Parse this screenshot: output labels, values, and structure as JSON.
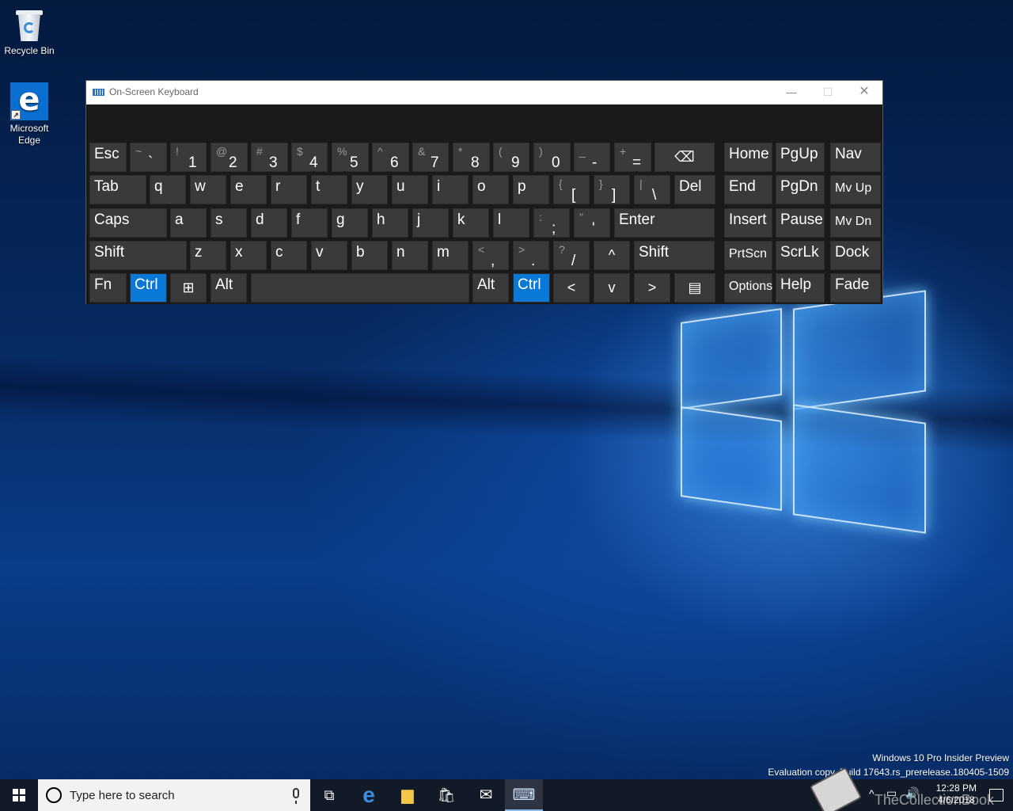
{
  "desktop": {
    "icons": [
      {
        "label": "Recycle Bin",
        "glyph": "recycle-bin-icon"
      },
      {
        "label": "Microsoft Edge",
        "glyph": "edge-icon"
      }
    ],
    "watermark_line1": "Windows 10 Pro Insider Preview",
    "watermark_line2": "Evaluation copy. Build 17643.rs_prerelease.180405-1509",
    "brand_text": "TheCollectionBook"
  },
  "osk": {
    "title": "On-Screen Keyboard",
    "minimize": "—",
    "maximize": "☐",
    "close": "✕",
    "rows": [
      [
        {
          "id": "esc",
          "main": "Esc"
        },
        {
          "id": "backtick",
          "shift": "~",
          "base": "`"
        },
        {
          "id": "k1",
          "shift": "!",
          "base": "1"
        },
        {
          "id": "k2",
          "shift": "@",
          "base": "2"
        },
        {
          "id": "k3",
          "shift": "#",
          "base": "3"
        },
        {
          "id": "k4",
          "shift": "$",
          "base": "4"
        },
        {
          "id": "k5",
          "shift": "%",
          "base": "5"
        },
        {
          "id": "k6",
          "shift": "^",
          "base": "6"
        },
        {
          "id": "k7",
          "shift": "&",
          "base": "7"
        },
        {
          "id": "k8",
          "shift": "*",
          "base": "8"
        },
        {
          "id": "k9",
          "shift": "(",
          "base": "9"
        },
        {
          "id": "k0",
          "shift": ")",
          "base": "0"
        },
        {
          "id": "minus",
          "shift": "_",
          "base": "-"
        },
        {
          "id": "equals",
          "shift": "+",
          "base": "="
        },
        {
          "id": "backspace",
          "icon": "⌫"
        },
        {
          "id": "home",
          "main": "Home"
        },
        {
          "id": "pgup",
          "main": "PgUp"
        },
        {
          "id": "nav",
          "main": "Nav"
        }
      ],
      [
        {
          "id": "tab",
          "main": "Tab"
        },
        {
          "id": "q",
          "main": "q"
        },
        {
          "id": "w",
          "main": "w"
        },
        {
          "id": "e",
          "main": "e"
        },
        {
          "id": "r",
          "main": "r"
        },
        {
          "id": "t",
          "main": "t"
        },
        {
          "id": "y",
          "main": "y"
        },
        {
          "id": "u",
          "main": "u"
        },
        {
          "id": "i",
          "main": "i"
        },
        {
          "id": "o",
          "main": "o"
        },
        {
          "id": "p",
          "main": "p"
        },
        {
          "id": "lbracket",
          "shift": "{",
          "base": "["
        },
        {
          "id": "rbracket",
          "shift": "}",
          "base": "]"
        },
        {
          "id": "backslash",
          "shift": "|",
          "base": "\\"
        },
        {
          "id": "del",
          "main": "Del"
        },
        {
          "id": "end",
          "main": "End"
        },
        {
          "id": "pgdn",
          "main": "PgDn"
        },
        {
          "id": "mvup",
          "main": "Mv Up",
          "small": true
        }
      ],
      [
        {
          "id": "caps",
          "main": "Caps"
        },
        {
          "id": "a",
          "main": "a"
        },
        {
          "id": "s",
          "main": "s"
        },
        {
          "id": "d",
          "main": "d"
        },
        {
          "id": "f",
          "main": "f"
        },
        {
          "id": "g",
          "main": "g"
        },
        {
          "id": "h",
          "main": "h"
        },
        {
          "id": "j",
          "main": "j"
        },
        {
          "id": "k",
          "main": "k"
        },
        {
          "id": "l",
          "main": "l"
        },
        {
          "id": "semicolon",
          "shift": ":",
          "base": ";"
        },
        {
          "id": "quote",
          "shift": "\"",
          "base": "'"
        },
        {
          "id": "enter",
          "main": "Enter"
        },
        {
          "id": "insert",
          "main": "Insert"
        },
        {
          "id": "pause",
          "main": "Pause"
        },
        {
          "id": "mvdn",
          "main": "Mv Dn",
          "small": true
        }
      ],
      [
        {
          "id": "lshift",
          "main": "Shift"
        },
        {
          "id": "z",
          "main": "z"
        },
        {
          "id": "x",
          "main": "x"
        },
        {
          "id": "c",
          "main": "c"
        },
        {
          "id": "v",
          "main": "v"
        },
        {
          "id": "b",
          "main": "b"
        },
        {
          "id": "n",
          "main": "n"
        },
        {
          "id": "m",
          "main": "m"
        },
        {
          "id": "comma",
          "shift": "<",
          "base": ","
        },
        {
          "id": "period",
          "shift": ">",
          "base": "."
        },
        {
          "id": "slash",
          "shift": "?",
          "base": "/"
        },
        {
          "id": "up",
          "icon": "^"
        },
        {
          "id": "rshift",
          "main": "Shift"
        },
        {
          "id": "prtscn",
          "main": "PrtScn",
          "small": true
        },
        {
          "id": "scrlk",
          "main": "ScrLk"
        },
        {
          "id": "dock",
          "main": "Dock"
        }
      ],
      [
        {
          "id": "fn",
          "main": "Fn"
        },
        {
          "id": "lctrl",
          "main": "Ctrl",
          "active": true
        },
        {
          "id": "win",
          "icon": "⊞"
        },
        {
          "id": "lalt",
          "main": "Alt"
        },
        {
          "id": "space",
          "main": ""
        },
        {
          "id": "ralt",
          "main": "Alt"
        },
        {
          "id": "rctrl",
          "main": "Ctrl",
          "active": true
        },
        {
          "id": "left",
          "icon": "<"
        },
        {
          "id": "down",
          "icon": "v"
        },
        {
          "id": "right",
          "icon": ">"
        },
        {
          "id": "menu",
          "icon": "▤"
        },
        {
          "id": "options",
          "main": "Options",
          "small": true
        },
        {
          "id": "help",
          "main": "Help"
        },
        {
          "id": "fade",
          "main": "Fade"
        }
      ]
    ]
  },
  "taskbar": {
    "search_placeholder": "Type here to search",
    "clock_time": "12:28 PM",
    "clock_date": "4/6/2018",
    "pinned": [
      {
        "name": "task-view-icon",
        "glyph": "⧉"
      },
      {
        "name": "edge-taskbar-icon",
        "glyph": "e"
      },
      {
        "name": "file-explorer-icon",
        "glyph": "▆"
      },
      {
        "name": "store-icon",
        "glyph": "🛍"
      },
      {
        "name": "mail-icon",
        "glyph": "✉"
      },
      {
        "name": "osk-taskbar-icon",
        "glyph": "⌨"
      }
    ],
    "tray_icons": [
      "chevron-up-icon",
      "network-icon",
      "volume-icon"
    ]
  }
}
